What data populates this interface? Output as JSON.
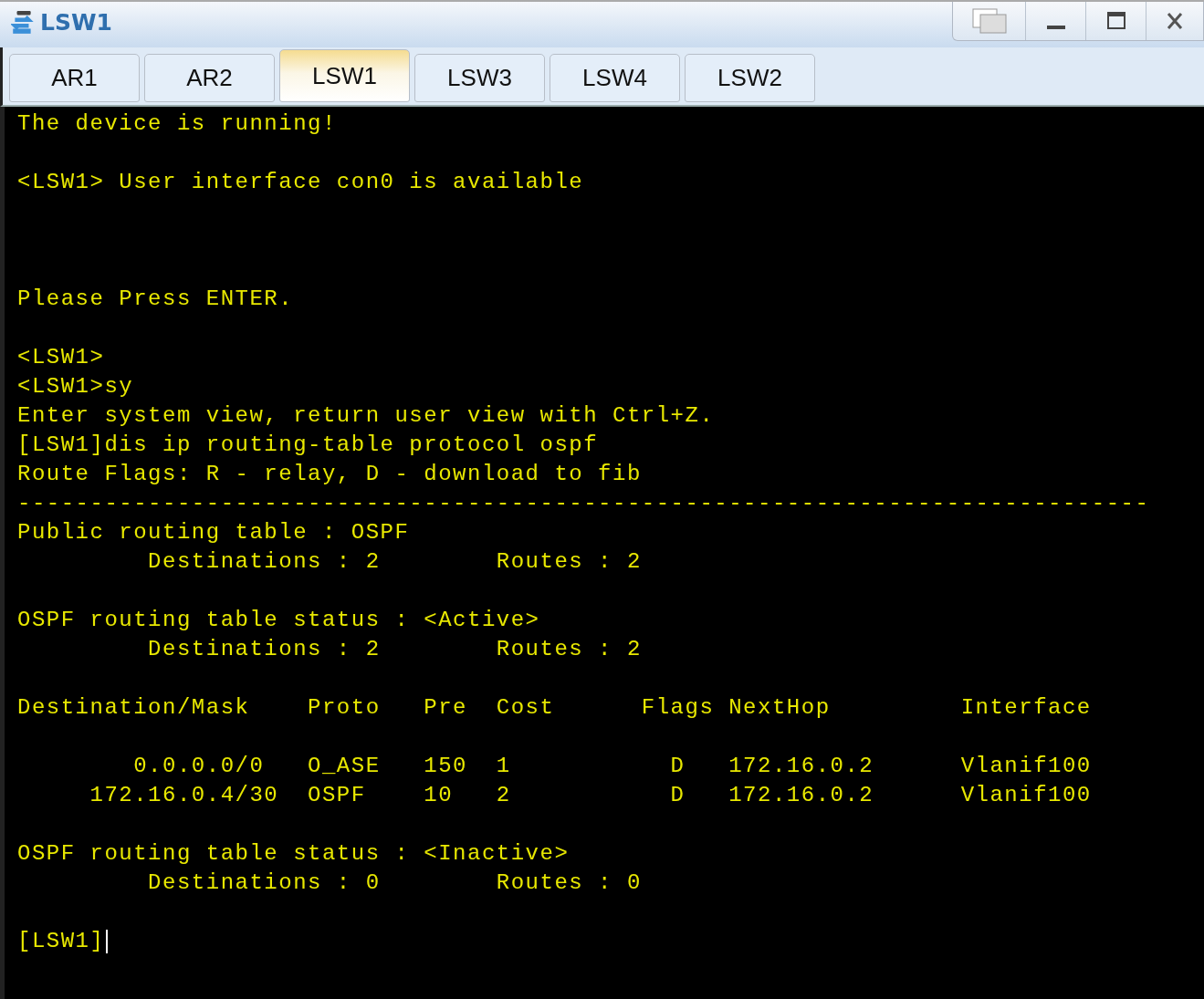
{
  "window": {
    "title": "LSW1"
  },
  "tabs": [
    {
      "label": "AR1",
      "selected": false
    },
    {
      "label": "AR2",
      "selected": false
    },
    {
      "label": "LSW1",
      "selected": true
    },
    {
      "label": "LSW3",
      "selected": false
    },
    {
      "label": "LSW4",
      "selected": false
    },
    {
      "label": "LSW2",
      "selected": false
    }
  ],
  "terminal": {
    "lines": [
      {
        "kind": "text",
        "text": "The device is running!"
      },
      {
        "kind": "blank"
      },
      {
        "kind": "text",
        "text": "<LSW1> User interface con0 is available"
      },
      {
        "kind": "blank"
      },
      {
        "kind": "blank"
      },
      {
        "kind": "blank"
      },
      {
        "kind": "text",
        "text": "Please Press ENTER."
      },
      {
        "kind": "blank"
      },
      {
        "kind": "text",
        "text": "<LSW1>"
      },
      {
        "kind": "text",
        "text": "<LSW1>sy"
      },
      {
        "kind": "text",
        "text": "Enter system view, return user view with Ctrl+Z."
      },
      {
        "kind": "text",
        "text": "[LSW1]dis ip routing-table protocol ospf"
      },
      {
        "kind": "text",
        "text": "Route Flags: R - relay, D - download to fib"
      },
      {
        "kind": "text",
        "text": "------------------------------------------------------------------------------"
      },
      {
        "kind": "text",
        "text": "Public routing table : OSPF"
      },
      {
        "kind": "text",
        "text": "         Destinations : 2        Routes : 2"
      },
      {
        "kind": "blank"
      },
      {
        "kind": "text",
        "text": "OSPF routing table status : <Active>"
      },
      {
        "kind": "text",
        "text": "         Destinations : 2        Routes : 2"
      },
      {
        "kind": "blank"
      },
      {
        "kind": "text",
        "text": "Destination/Mask    Proto   Pre  Cost      Flags NextHop         Interface"
      },
      {
        "kind": "blank"
      },
      {
        "kind": "text",
        "text": "        0.0.0.0/0   O_ASE   150  1           D   172.16.0.2      Vlanif100"
      },
      {
        "kind": "text",
        "text": "     172.16.0.4/30  OSPF    10   2           D   172.16.0.2      Vlanif100"
      },
      {
        "kind": "blank"
      },
      {
        "kind": "text",
        "text": "OSPF routing table status : <Inactive>"
      },
      {
        "kind": "text",
        "text": "         Destinations : 0        Routes : 0"
      },
      {
        "kind": "blank"
      },
      {
        "kind": "prompt",
        "text": "[LSW1]"
      }
    ]
  }
}
